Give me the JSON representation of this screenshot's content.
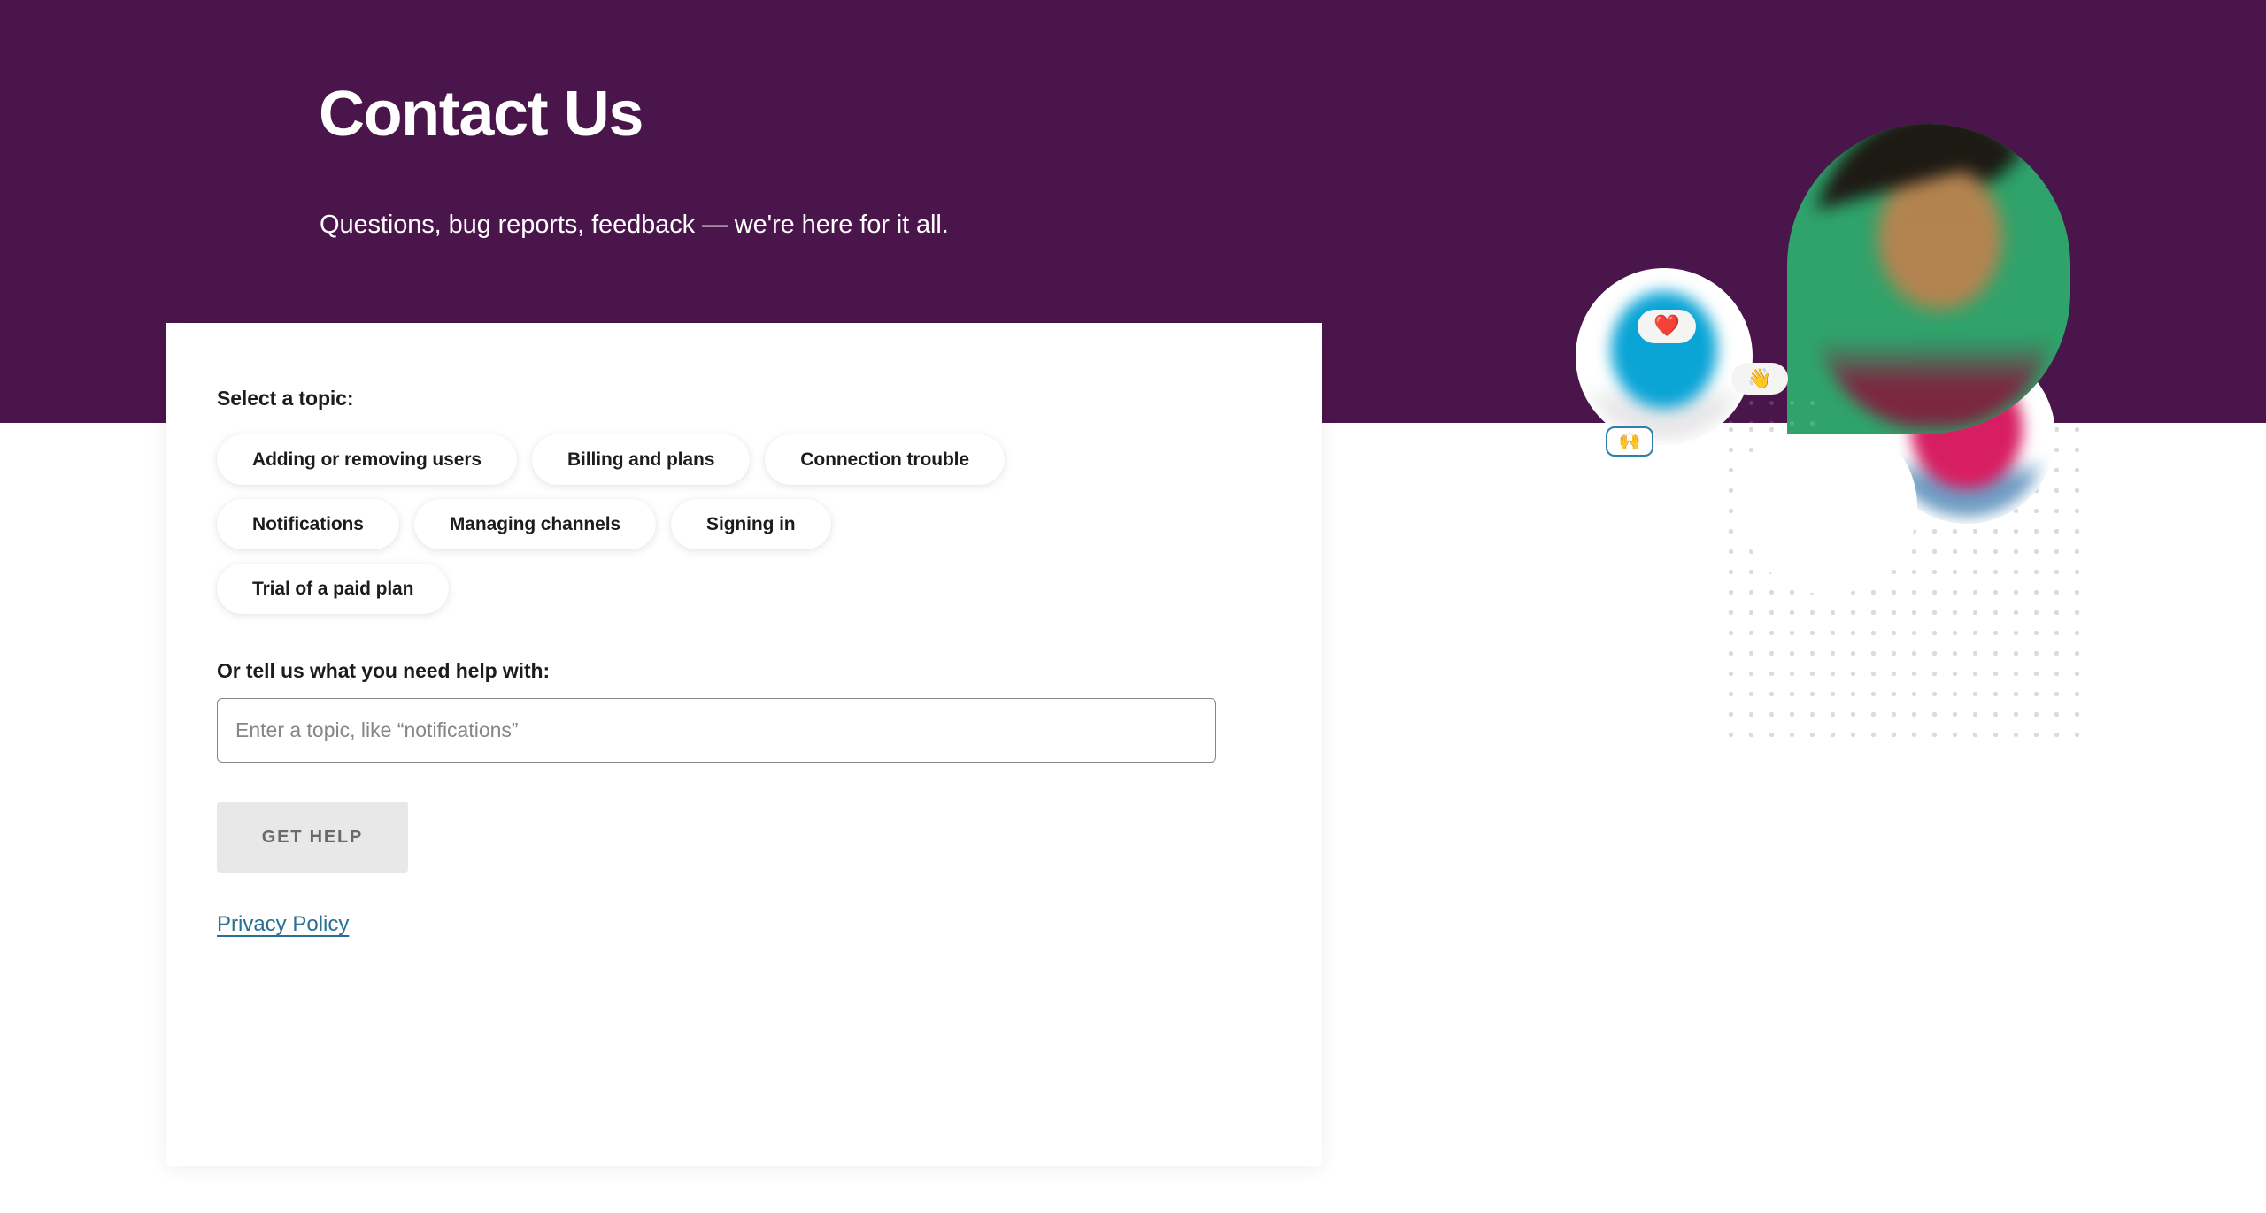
{
  "theme": {
    "brand_purple": "#4A154B",
    "link_blue": "#2a6f95",
    "button_bg": "#e8e8e8",
    "button_text": "#696969",
    "card_bg": "#ffffff",
    "text_primary": "#1d1c1d",
    "placeholder_gray": "#868686"
  },
  "hero": {
    "title": "Contact Us",
    "subtitle": "Questions, bug reports, feedback — we're here for it all."
  },
  "form": {
    "topic_label": "Select a topic:",
    "topics": [
      [
        {
          "label": "Adding or removing users"
        },
        {
          "label": "Billing and plans"
        },
        {
          "label": "Connection trouble"
        }
      ],
      [
        {
          "label": "Notifications"
        },
        {
          "label": "Managing channels"
        },
        {
          "label": "Signing in"
        }
      ],
      [
        {
          "label": "Trial of a paid plan"
        }
      ]
    ],
    "free_text_label": "Or tell us what you need help with:",
    "free_text_value": "",
    "free_text_placeholder": "Enter a topic, like “notifications”",
    "submit_label": "GET HELP",
    "privacy_link_label": "Privacy Policy"
  },
  "illustration": {
    "avatars": [
      {
        "name": "avatar-green",
        "backdrop_color": "#2FA36B"
      },
      {
        "name": "avatar-blue",
        "backdrop_color": "#0aa4d6"
      },
      {
        "name": "avatar-pink",
        "backdrop_color": "#d81e62"
      },
      {
        "name": "avatar-yellow",
        "backdrop_color": "#e9b719"
      }
    ],
    "reactions": [
      {
        "name": "heart-emoji",
        "glyph": "❤️"
      },
      {
        "name": "wave-emoji",
        "glyph": "👋"
      },
      {
        "name": "raised-hands-emoji",
        "glyph": "🙌"
      }
    ]
  }
}
